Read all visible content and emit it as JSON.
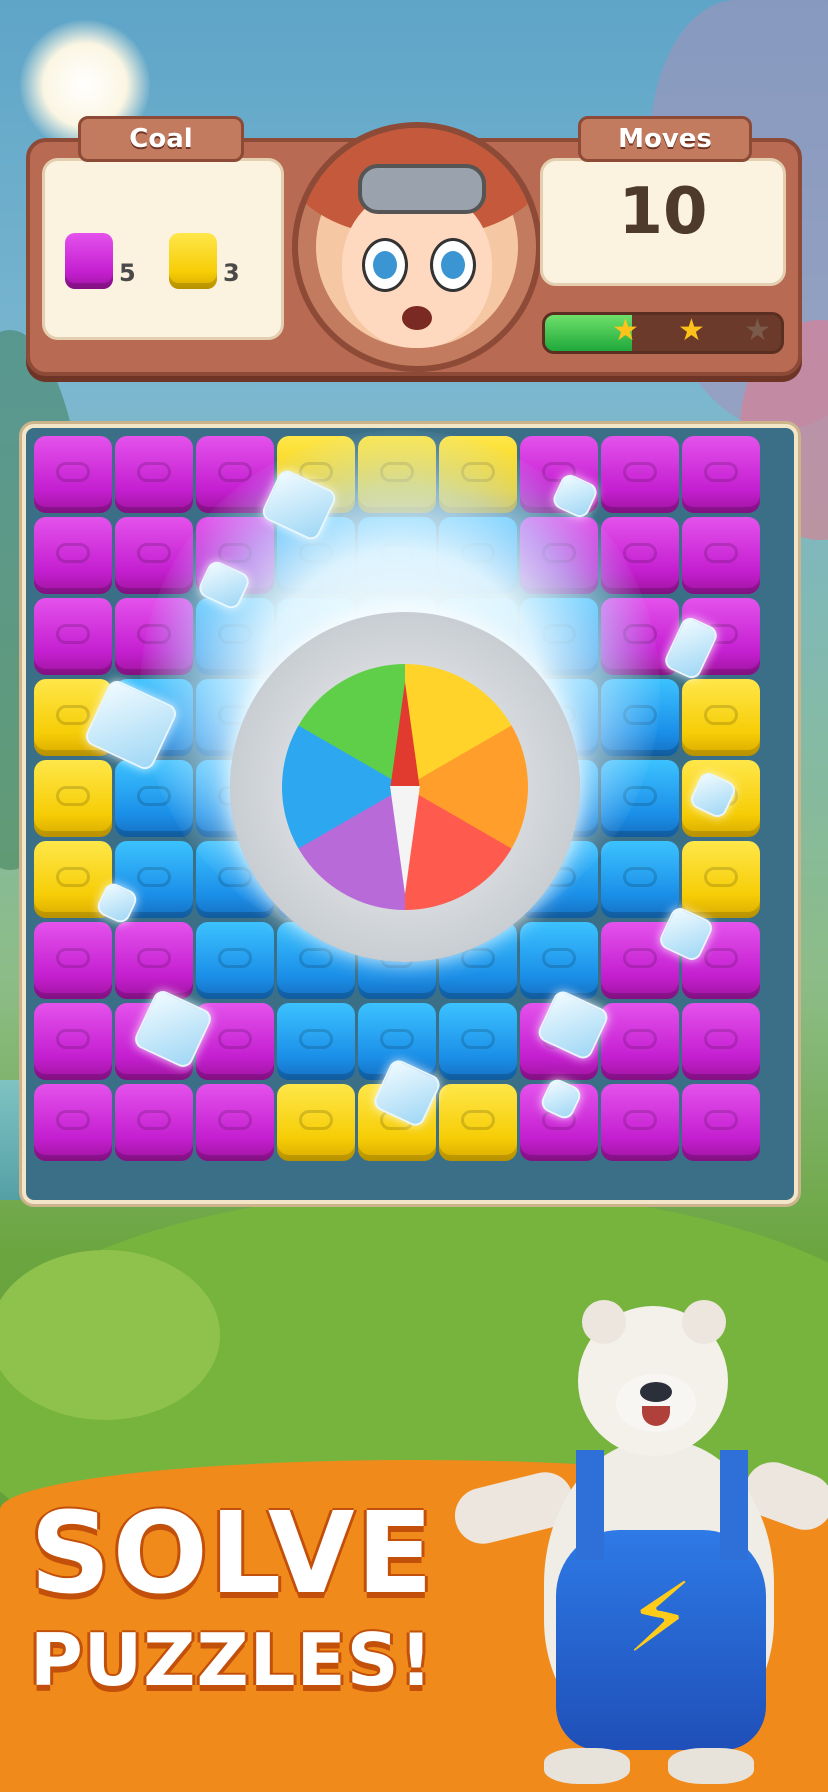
{
  "hud": {
    "goal_label": "Coal",
    "moves_label": "Moves",
    "moves_value": "10",
    "goals": [
      {
        "icon": "magenta-cube-icon",
        "count": "5",
        "color": "#d22bdc"
      },
      {
        "icon": "yellow-cube-icon",
        "count": "3",
        "color": "#f5d10e"
      }
    ],
    "progress": 0.37,
    "stars": [
      {
        "filled": true,
        "glyph": "★"
      },
      {
        "filled": true,
        "glyph": "★"
      },
      {
        "filled": false,
        "glyph": "★"
      }
    ]
  },
  "board": {
    "rows": 9,
    "cols": 9,
    "grid": [
      [
        "M",
        "M",
        "M",
        "Y",
        "Y",
        "Y",
        "M",
        "M",
        "M"
      ],
      [
        "M",
        "M",
        "M",
        "B",
        "B",
        "B",
        "M",
        "M",
        "M"
      ],
      [
        "M",
        "M",
        "B",
        "B",
        "B",
        "B",
        "B",
        "M",
        "M"
      ],
      [
        "Y",
        "B",
        "B",
        "B",
        "B",
        "B",
        "B",
        "B",
        "Y"
      ],
      [
        "Y",
        "B",
        "B",
        "B",
        "B",
        "B",
        "B",
        "B",
        "Y"
      ],
      [
        "Y",
        "B",
        "B",
        "B",
        "B",
        "B",
        "B",
        "B",
        "Y"
      ],
      [
        "M",
        "M",
        "B",
        "B",
        "B",
        "B",
        "B",
        "M",
        "M"
      ],
      [
        "M",
        "M",
        "M",
        "B",
        "B",
        "B",
        "M",
        "M",
        "M"
      ],
      [
        "M",
        "M",
        "M",
        "Y",
        "Y",
        "Y",
        "M",
        "M",
        "M"
      ]
    ],
    "colors": {
      "M": "#d22bdc",
      "Y": "#f5d10e",
      "B": "#1f93ea"
    },
    "booster": "compass-icon"
  },
  "promo": {
    "line1": "SOLVE",
    "line2": "PUZZLES!",
    "bolt": "⚡"
  }
}
